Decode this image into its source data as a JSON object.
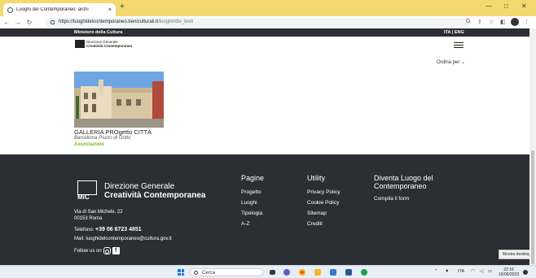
{
  "browser": {
    "tab_title": "Luoghi del Contemporaneo: archi",
    "tab_close": "×",
    "new_tab": "+",
    "url_domain": "https://luoghidelcontemporaneo.beniculturali.it",
    "url_path": "/luoghi#div_testi",
    "win_minimize": "—",
    "win_maximize": "□",
    "win_close": "✕"
  },
  "site": {
    "ministry": "Ministero della Cultura",
    "lang": "ITA | ENG",
    "logo_line1": "Direzione Generale",
    "logo_line2": "Creatività Contemporanea",
    "sort_label": "Ordina per ⌄"
  },
  "card": {
    "title": "GALLERIA PROgetto CITTÀ",
    "location": "Barcellona Pozzo di Gotto",
    "tag": "Associazioni"
  },
  "footer": {
    "logo_line1": "Direzione Generale",
    "logo_line2": "Creatività Contemporanea",
    "mic": "MiC",
    "address_line1": "Via di San Michele, 22",
    "address_line2": "00153 Roma",
    "phone_label": "Telefono: ",
    "phone": "+39 06 6723 4851",
    "mail_label": "Mail: ",
    "mail": "luoghidelcontemporaneo@cultura.gov.it",
    "follow": "Follow us on",
    "pages_heading": "Pagine",
    "pages": [
      "Progetto",
      "Luoghi",
      "Tipologia",
      "A-Z"
    ],
    "utility_heading": "Utility",
    "utility": [
      "Privacy Policy",
      "Cookie Policy",
      "Sitemap",
      "Crediti"
    ],
    "become_heading": "Diventa Luogo del Contemporaneo",
    "become_link": "Compila il form"
  },
  "tooltip": "Mostra desktop",
  "taskbar": {
    "search": "Cerca",
    "lang": "ITA",
    "time": "22:16",
    "date": "15/06/2023"
  }
}
